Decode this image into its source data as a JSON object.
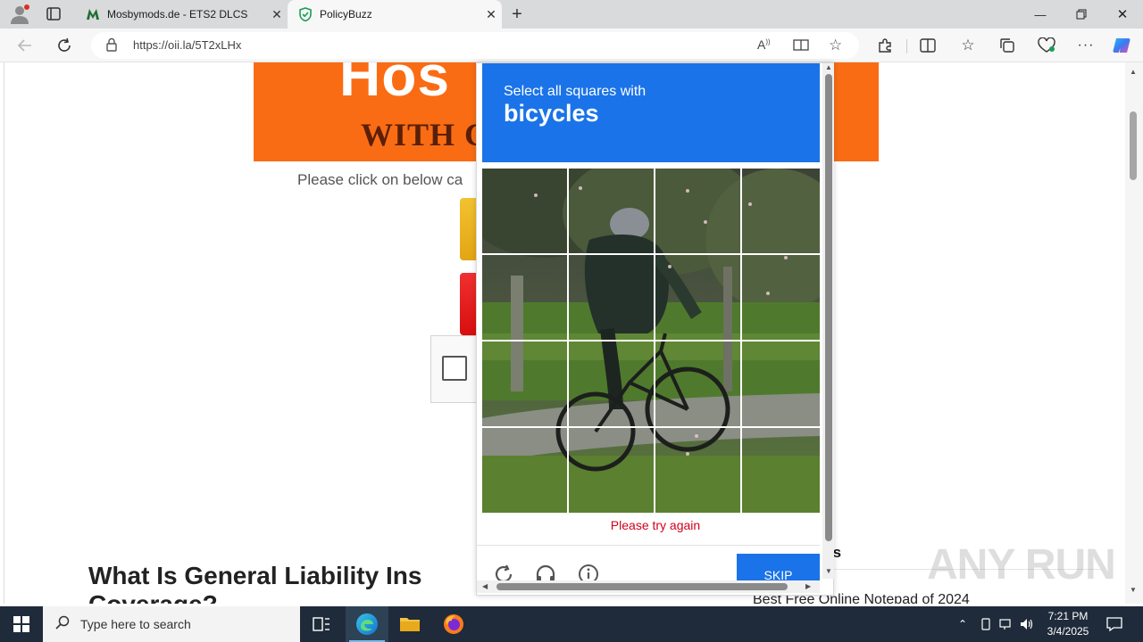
{
  "browser": {
    "tabs": [
      {
        "title": "Mosbymods.de - ETS2 DLCS",
        "active": false
      },
      {
        "title": "PolicyBuzz",
        "active": true
      }
    ],
    "url": "https://oii.la/5T2xLHx"
  },
  "page": {
    "banner_line1": "Hos",
    "banner_line2": "WITH C",
    "click_prompt": "Please click on below ca",
    "article_title_line1": "What Is General Liability Ins",
    "article_title_line2": "Coverage?",
    "side_heading": "ts",
    "side_link": "Best Free Online Notepad of 2024",
    "watermark": "ANY RUN"
  },
  "captcha": {
    "prompt": "Select all squares with",
    "object": "bicycles",
    "grid_size": 4,
    "error": "Please try again",
    "skip_label": "SKIP",
    "accent": "#1a73e8",
    "error_color": "#d0021b"
  },
  "taskbar": {
    "search_placeholder": "Type here to search",
    "time": "7:21 PM",
    "date": "3/4/2025"
  },
  "icons": {
    "tab_close": "close-icon",
    "new_tab": "plus-icon",
    "reload": "refresh-icon",
    "captcha_reload": "reload-icon",
    "captcha_audio": "headphones-icon",
    "captcha_info": "info-icon"
  }
}
